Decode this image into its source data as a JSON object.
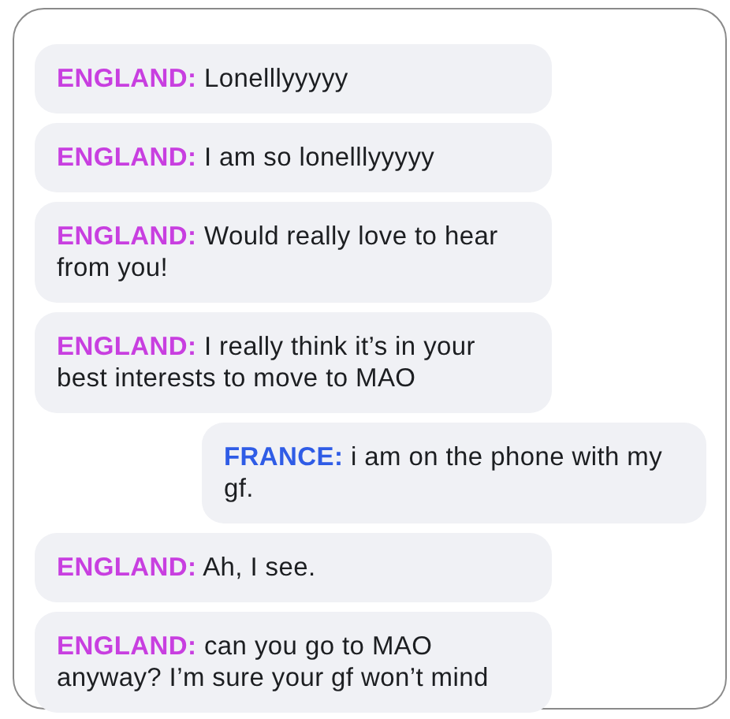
{
  "messages": [
    {
      "kind": "incoming",
      "sender": "ENGLAND:",
      "color": "#c83fe0",
      "text": "Lonelllyyyyy"
    },
    {
      "kind": "incoming",
      "sender": "ENGLAND:",
      "color": "#c83fe0",
      "text": "I am so lonelllyyyyy"
    },
    {
      "kind": "incoming",
      "sender": "ENGLAND:",
      "color": "#c83fe0",
      "text": "Would really love to hear from you!"
    },
    {
      "kind": "incoming",
      "sender": "ENGLAND:",
      "color": "#c83fe0",
      "text": "I really think it’s in your best interests to move to MAO"
    },
    {
      "kind": "outgoing",
      "sender": "FRANCE:",
      "color": "#2f5ce6",
      "text": "i am on the phone with my gf."
    },
    {
      "kind": "incoming",
      "sender": "ENGLAND:",
      "color": "#c83fe0",
      "text": "Ah, I see."
    },
    {
      "kind": "incoming",
      "sender": "ENGLAND:",
      "color": "#c83fe0",
      "text": "can you go to MAO anyway? I’m sure your gf won’t mind"
    }
  ]
}
